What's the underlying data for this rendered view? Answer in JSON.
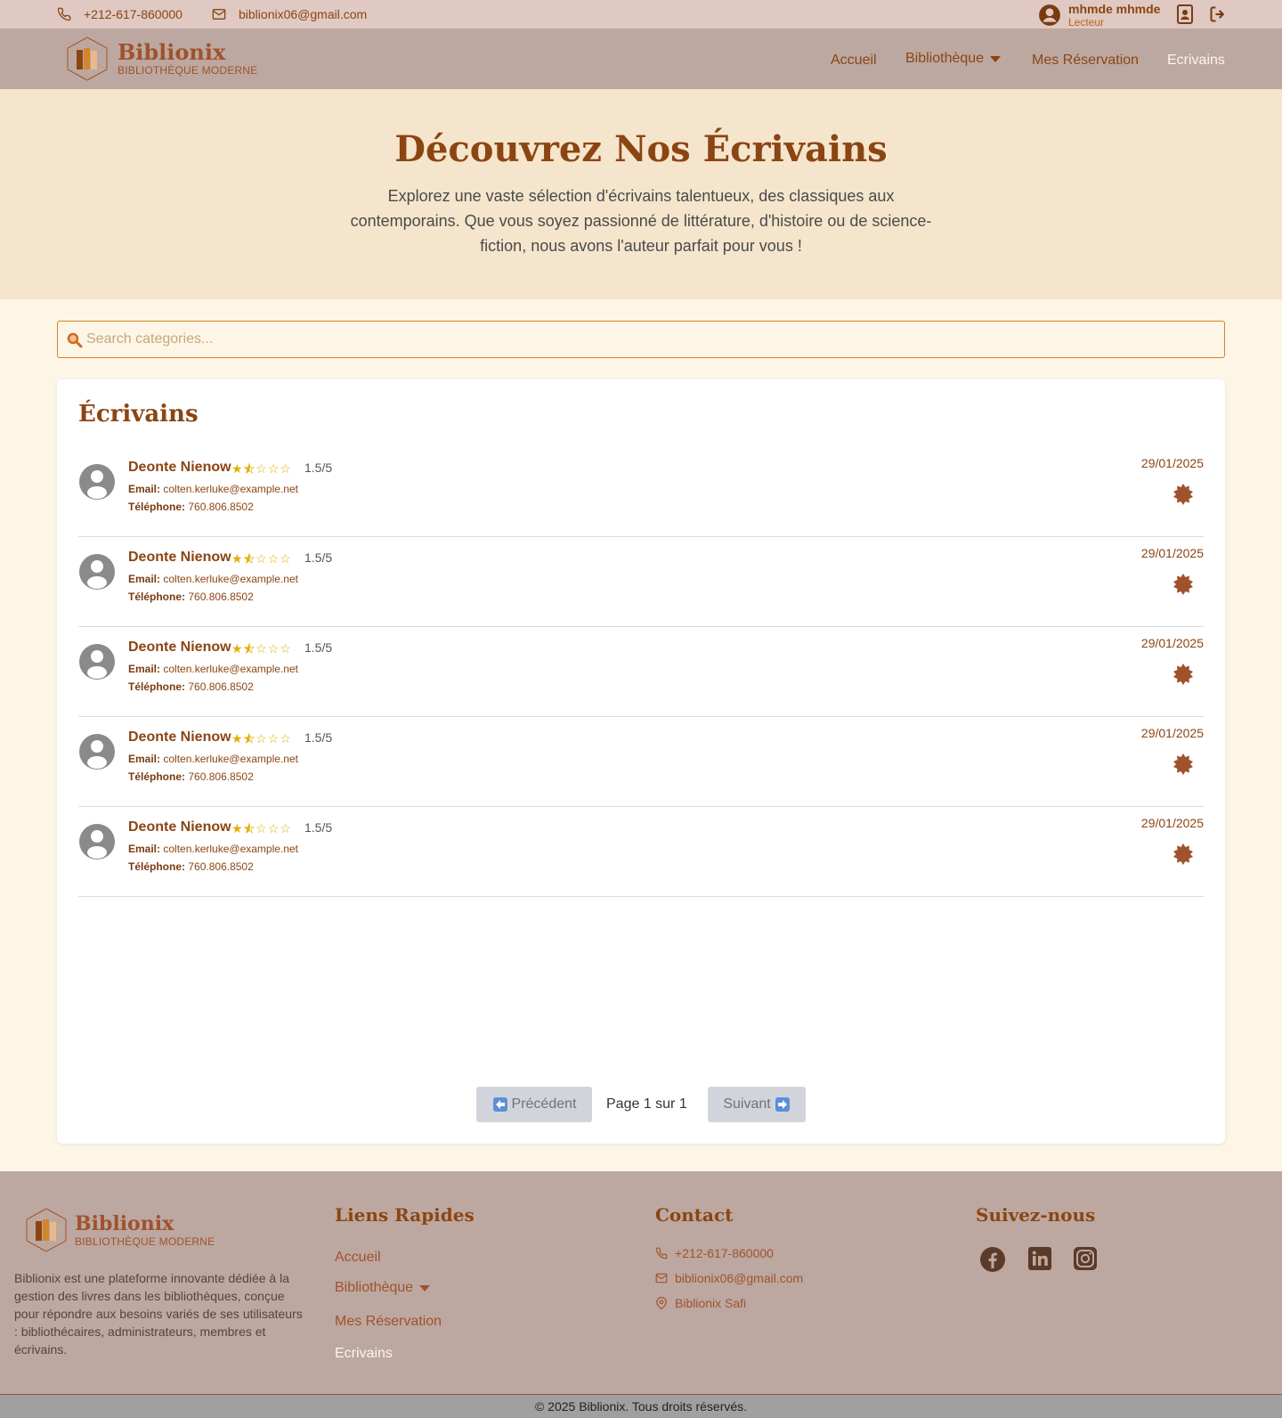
{
  "topbar": {
    "phone": "+212-617-860000",
    "email": "biblionix06@gmail.com",
    "user_name": "mhmde mhmde",
    "user_role": "Lecteur"
  },
  "brand": {
    "name": "Biblionix",
    "tagline": "BIBLIOTHÈQUE MODERNE"
  },
  "nav": {
    "home": "Accueil",
    "library": "Bibliothèque",
    "reservations": "Mes Réservation",
    "writers": "Ecrivains"
  },
  "hero": {
    "title": "Découvrez Nos Écrivains",
    "description": "Explorez une vaste sélection d'écrivains talentueux, des classiques aux contemporains. Que vous soyez passionné de littérature, d'histoire ou de science-fiction, nous avons l'auteur parfait pour vous !"
  },
  "search": {
    "placeholder": "Search categories..."
  },
  "writers_section": {
    "title": "Écrivains",
    "email_label": "Email:",
    "phone_label": "Téléphone:",
    "items": [
      {
        "name": "Deonte Nienow",
        "rating": "1.5/5",
        "rating_value": 1.5,
        "email": "colten.kerluke@example.net",
        "phone": "760.806.8502",
        "date": "29/01/2025"
      },
      {
        "name": "Deonte Nienow",
        "rating": "1.5/5",
        "rating_value": 1.5,
        "email": "colten.kerluke@example.net",
        "phone": "760.806.8502",
        "date": "29/01/2025"
      },
      {
        "name": "Deonte Nienow",
        "rating": "1.5/5",
        "rating_value": 1.5,
        "email": "colten.kerluke@example.net",
        "phone": "760.806.8502",
        "date": "29/01/2025"
      },
      {
        "name": "Deonte Nienow",
        "rating": "1.5/5",
        "rating_value": 1.5,
        "email": "colten.kerluke@example.net",
        "phone": "760.806.8502",
        "date": "29/01/2025"
      },
      {
        "name": "Deonte Nienow",
        "rating": "1.5/5",
        "rating_value": 1.5,
        "email": "colten.kerluke@example.net",
        "phone": "760.806.8502",
        "date": "29/01/2025"
      }
    ]
  },
  "pagination": {
    "prev": "Précédent",
    "info": "Page 1 sur 1",
    "next": "Suivant"
  },
  "footer": {
    "description": "Biblionix est une plateforme innovante dédiée à la gestion des livres dans les bibliothèques, conçue pour répondre aux besoins variés de ses utilisateurs : bibliothécaires, administrateurs, membres et écrivains.",
    "quick_links_title": "Liens Rapides",
    "contact_title": "Contact",
    "contact_phone": "+212-617-860000",
    "contact_email": "biblionix06@gmail.com",
    "contact_address": "Biblionix Safi",
    "follow_title": "Suivez-nous",
    "social_icons": [
      "facebook-icon",
      "linkedin-icon",
      "instagram-icon"
    ],
    "copyright": "© 2025 Biblionix. Tous droits réservés."
  },
  "colors": {
    "brand": "#8b4513",
    "accent": "#a0522d",
    "star": "#e0b000",
    "navbar": "#bca8a0",
    "hero": "#f5e5cc"
  }
}
